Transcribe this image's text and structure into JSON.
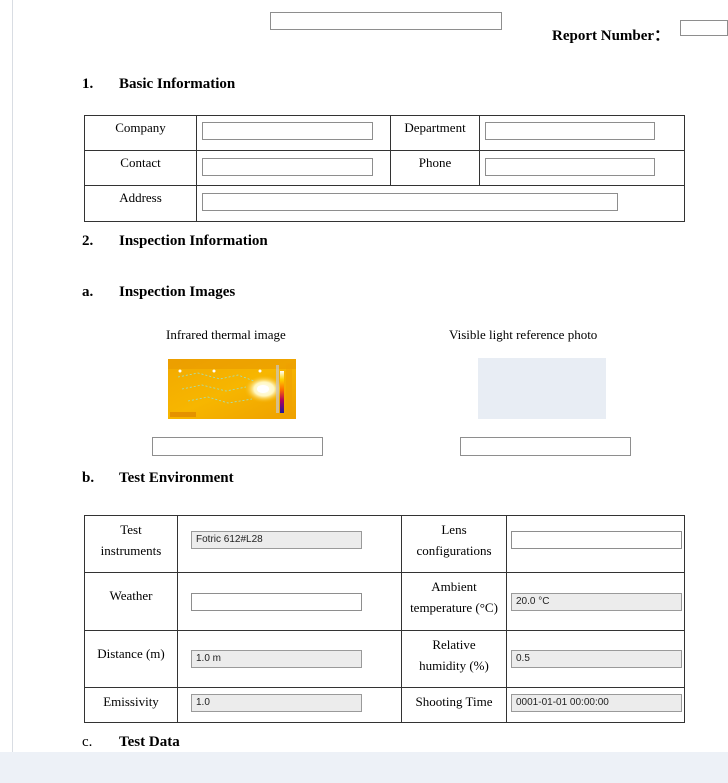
{
  "report": {
    "title_value": "",
    "number_label": "Report Number：",
    "number_value": ""
  },
  "section1": {
    "num": "1.",
    "title": "Basic Information",
    "company_label": "Company",
    "company_value": "",
    "department_label": "Department",
    "department_value": "",
    "contact_label": "Contact",
    "contact_value": "",
    "phone_label": "Phone",
    "phone_value": "",
    "address_label": "Address",
    "address_value": ""
  },
  "section2": {
    "num": "2.",
    "title": "Inspection Information"
  },
  "images": {
    "num": "a.",
    "title": "Inspection Images",
    "infrared_caption": "Infrared thermal image",
    "infrared_name": "",
    "visible_caption": "Visible light reference photo",
    "visible_name": ""
  },
  "environment": {
    "num": "b.",
    "title": "Test Environment",
    "instruments_label_1": "Test",
    "instruments_label_2": "instruments",
    "instruments_value": "Fotric 612#L28",
    "lens_label_1": "Lens",
    "lens_label_2": "configurations",
    "lens_value": "",
    "weather_label": "Weather",
    "weather_value": "",
    "ambient_label_1": "Ambient",
    "ambient_label_2": "temperature (°C)",
    "ambient_value": "20.0 °C",
    "distance_label": "Distance (m)",
    "distance_value": "1.0 m",
    "humidity_label_1": "Relative",
    "humidity_label_2": "humidity (%)",
    "humidity_value": "0.5",
    "emissivity_label": "Emissivity",
    "emissivity_value": "1.0",
    "shooting_time_label": "Shooting Time",
    "shooting_time_value": "0001-01-01 00:00:00"
  },
  "test_data": {
    "num": "c.",
    "title": "Test Data"
  }
}
